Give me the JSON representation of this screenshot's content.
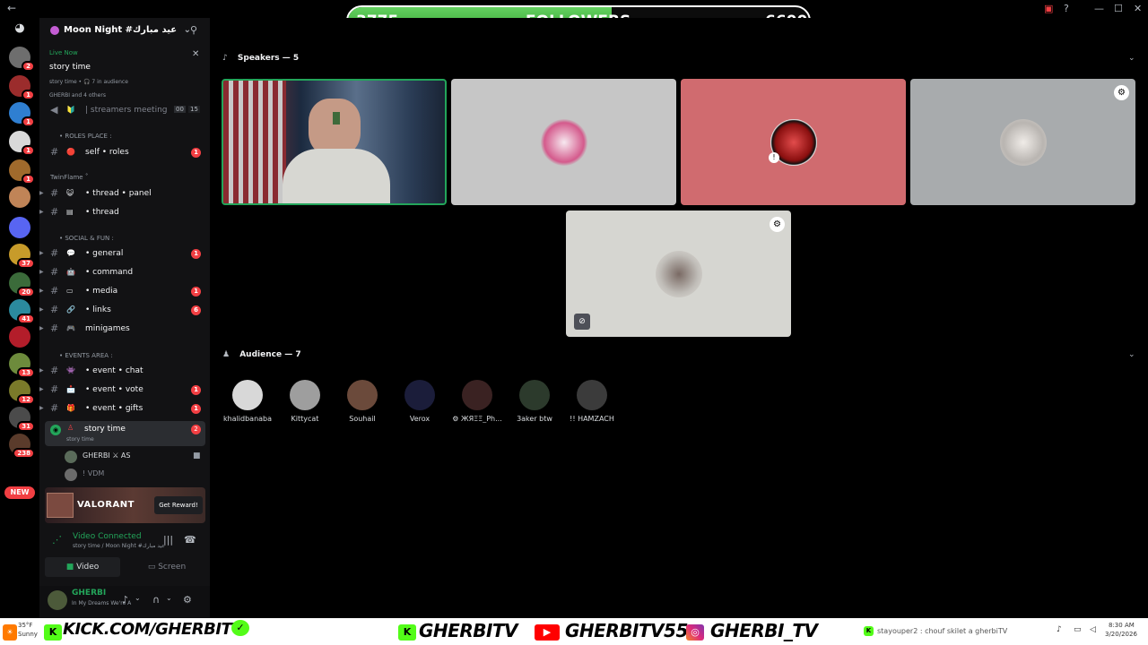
{
  "followers": {
    "current": "3775",
    "label": "FOLLOWERS",
    "goal": "6600",
    "progress": 0.572
  },
  "rail": {
    "servers": [
      {
        "name": "discord-home",
        "color": "#5865f2",
        "badge": ""
      },
      {
        "name": "server-1",
        "color": "#6e6e6e",
        "badge": "2"
      },
      {
        "name": "server-2",
        "color": "#9b2c2c",
        "badge": "1"
      },
      {
        "name": "server-3",
        "color": "#2f7fd1",
        "badge": "1"
      },
      {
        "name": "server-4",
        "color": "#d9d9d9",
        "badge": "1"
      },
      {
        "name": "server-5",
        "color": "#a06a2c",
        "badge": "1"
      },
      {
        "name": "server-6",
        "color": "#c08457",
        "badge": ""
      },
      {
        "name": "server-7",
        "color": "#5865f2",
        "badge": ""
      },
      {
        "name": "server-8",
        "color": "#c79b2a",
        "badge": "37"
      },
      {
        "name": "server-9",
        "color": "#3b6b3a",
        "badge": "20"
      },
      {
        "name": "server-10",
        "color": "#2b8a9e",
        "badge": "41"
      },
      {
        "name": "server-11",
        "color": "#b31d2a",
        "badge": ""
      },
      {
        "name": "server-12",
        "color": "#6d8b3c",
        "badge": "13"
      },
      {
        "name": "server-13",
        "color": "#7a7a2a",
        "badge": "12"
      },
      {
        "name": "server-14",
        "color": "#4b4b4b",
        "badge": "31"
      },
      {
        "name": "server-15",
        "color": "#5a3b2b",
        "badge": "238"
      }
    ],
    "new_label": "NEW"
  },
  "server": {
    "name": "Moon Night #عيد مبارك"
  },
  "live": {
    "status": "Live Now",
    "title": "story time",
    "info": "story time • 🎧 7 in audience",
    "people": "GHERBI and 4 others"
  },
  "channels": {
    "streamers": {
      "name": "| streamers meeting",
      "c1": "00",
      "c2": "15"
    },
    "cat_roles": "• ROLES PLACE :",
    "self_roles": {
      "name": "self • roles",
      "badge": "1"
    },
    "cat_twin": "TwinFlame ˚",
    "thread_panel": {
      "name": "• thread • panel"
    },
    "thread": {
      "name": "• thread"
    },
    "cat_social": "• SOCIAL & FUN :",
    "general": {
      "name": "• general",
      "badge": "1"
    },
    "command": {
      "name": "• command"
    },
    "media": {
      "name": "• media",
      "badge": "1"
    },
    "links": {
      "name": "• links",
      "badge": "6"
    },
    "minigames": {
      "name": "minigames"
    },
    "cat_events": "• EVENTS AREA :",
    "event_chat": {
      "name": "• event • chat"
    },
    "event_vote": {
      "name": "• event • vote",
      "badge": "1"
    },
    "event_gifts": {
      "name": "• event • gifts",
      "badge": "1"
    },
    "story": {
      "name": "story time",
      "sub": "story time",
      "badge": "2"
    },
    "voice_users": [
      {
        "name": "GHERBI ⚔ AS"
      },
      {
        "name": "! VDM"
      }
    ]
  },
  "promo": {
    "title": "VALORANT",
    "button": "Get Reward!"
  },
  "voice": {
    "status": "Video Connected",
    "sub": "story time / Moon Night #عيد مبارك",
    "video": "Video",
    "screen": "Screen"
  },
  "user": {
    "name": "GHERBI",
    "status": "In My Dreams We're A"
  },
  "main": {
    "speakers": "Speakers — 5",
    "audience": "Audience — 7",
    "audience_list": [
      {
        "name": "khalidbanaba",
        "color": "#d8d8d8"
      },
      {
        "name": "Kittycat",
        "color": "#9e9e9e"
      },
      {
        "name": "Souhail",
        "color": "#6b4a3b"
      },
      {
        "name": "Verox",
        "color": "#1b1d3a"
      },
      {
        "name": "⚙ ЖЯΞΞ_Ph...",
        "color": "#3a2222"
      },
      {
        "name": "3aker btw",
        "color": "#2c3a2c"
      },
      {
        "name": "!! HAMZACH",
        "color": "#3b3b3b"
      }
    ]
  },
  "bottom": {
    "kick": "KICK.COM/GHERBITV",
    "kick_handle": "GHERBITV",
    "youtube": "GHERBITV55",
    "instagram": "GHERBI_TV",
    "chat": "stayouper2 : chouf skilet a gherbiTV",
    "weather": "35°F",
    "weather_sub": "Sunny",
    "time": "8:30 AM",
    "date": "3/20/2026"
  }
}
